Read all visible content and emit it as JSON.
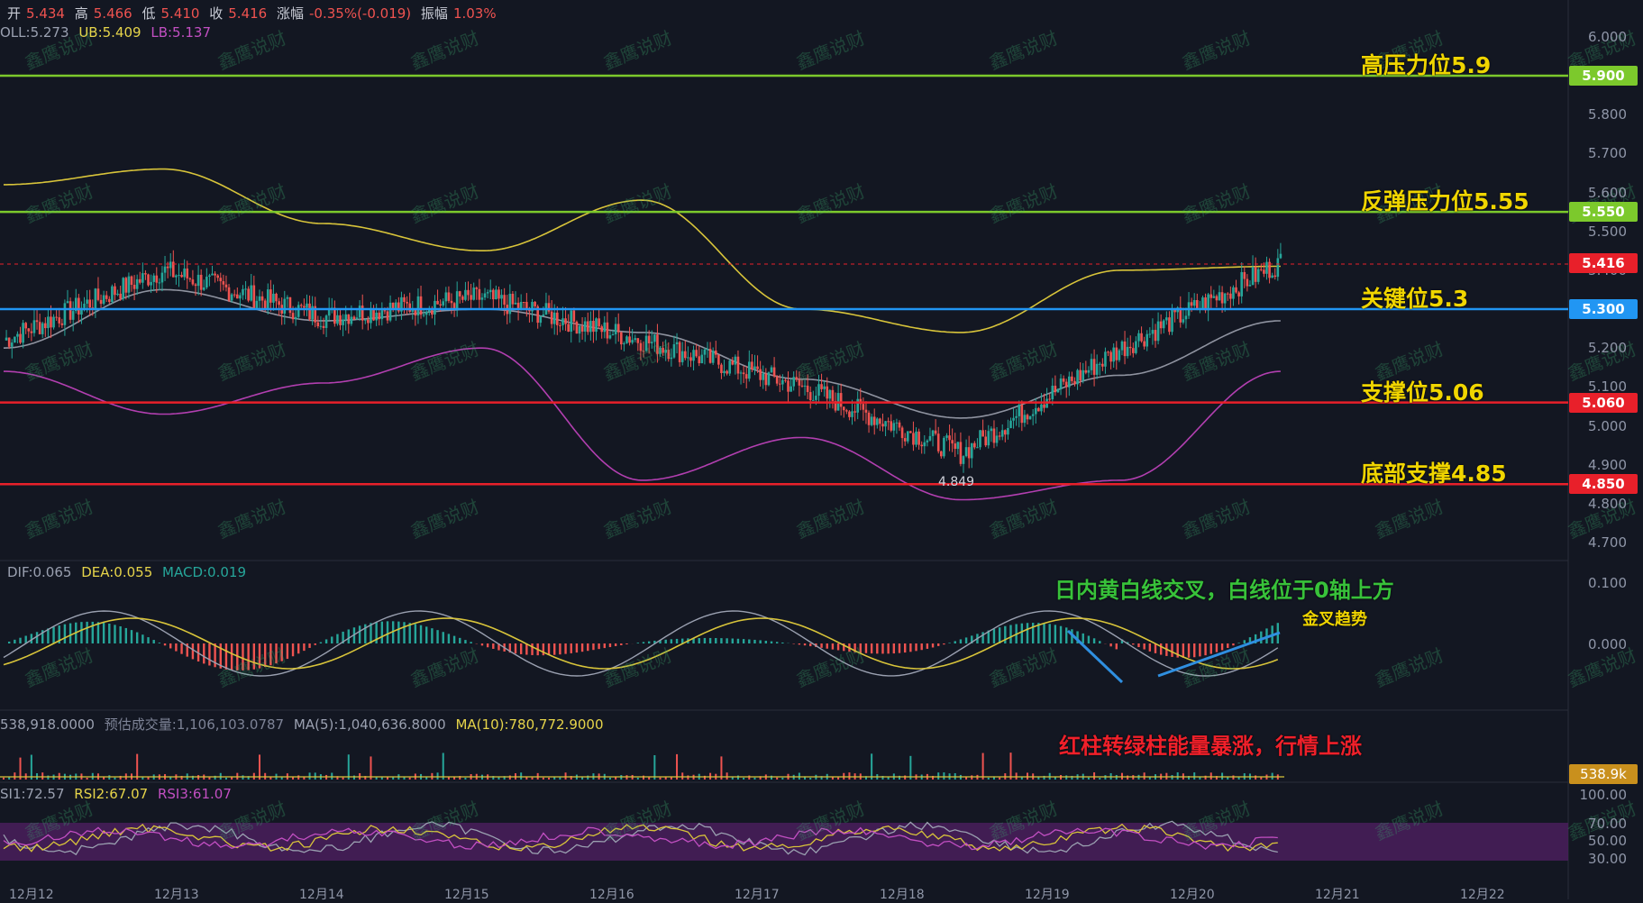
{
  "header": {
    "open_label": "开",
    "open": "5.434",
    "high_label": "高",
    "high": "5.466",
    "low_label": "低",
    "low": "5.410",
    "close_label": "收",
    "close": "5.416",
    "change_label": "涨幅",
    "change": "-0.35%(-0.019)",
    "amp_label": "振幅",
    "amp": "1.03%"
  },
  "boll": {
    "mid": "OLL:5.273",
    "ub": "UB:5.409",
    "lb": "LB:5.137"
  },
  "macd": {
    "dif": "DIF:0.065",
    "dea": "DEA:0.055",
    "macd": "MACD:0.019"
  },
  "volume": {
    "vol": "538,918.0000",
    "est": "预估成交量:1,106,103.0787",
    "ma5": "MA(5):1,040,636.8000",
    "ma10": "MA(10):780,772.9000",
    "tag": "538.9k"
  },
  "rsi": {
    "rsi1": "SI1:72.57",
    "rsi2": "RSI2:67.07",
    "rsi3": "RSI3:61.07"
  },
  "price_axis": [
    "6.000",
    "5.900",
    "5.800",
    "5.700",
    "5.600",
    "5.500",
    "5.400",
    "5.300",
    "5.200",
    "5.100",
    "5.000",
    "4.900",
    "4.800",
    "4.700"
  ],
  "macd_axis": [
    "0.100",
    "0.000"
  ],
  "rsi_axis": [
    "100.00",
    "70.00",
    "50.00",
    "30.00"
  ],
  "levels": [
    {
      "text": "高压力位5.9",
      "value": 5.9,
      "tag": "5.900",
      "color": "#7cc92c"
    },
    {
      "text": "反弹压力位5.55",
      "value": 5.55,
      "tag": "5.550",
      "color": "#7cc92c"
    },
    {
      "text": "关键位5.3",
      "value": 5.3,
      "tag": "5.300",
      "color": "#2196f3"
    },
    {
      "text": "支撑位5.06",
      "value": 5.06,
      "tag": "5.060",
      "color": "#e8202a"
    },
    {
      "text": "底部支撑4.85",
      "value": 4.85,
      "tag": "4.850",
      "color": "#e8202a"
    }
  ],
  "current_price_tag": "5.416",
  "low_marker": "4.849",
  "notes": {
    "macd_note": "日内黄白线交叉，白线位于0轴上方",
    "golden_cross": "金叉趋势",
    "volume_note": "红柱转绿柱能量暴涨，行情上涨"
  },
  "dates": [
    "12月12",
    "12月13",
    "12月14",
    "12月15",
    "12月16",
    "12月17",
    "12月18",
    "12月19",
    "12月20",
    "12月21",
    "12月22"
  ],
  "watermark": "鑫鹰说财",
  "chart_data": {
    "type": "line",
    "title": "",
    "x": [
      "12月12",
      "12月13",
      "12月14",
      "12月15",
      "12月16",
      "12月17",
      "12月18",
      "12月19",
      "12月20"
    ],
    "series": [
      {
        "values": [
          5.22,
          5.4,
          5.28,
          5.33,
          5.22,
          5.1,
          4.93,
          5.2,
          5.42
        ]
      },
      {
        "values": [
          5.2,
          5.35,
          5.27,
          5.3,
          5.24,
          5.12,
          5.02,
          5.13,
          5.27
        ]
      },
      {
        "values": [
          5.62,
          5.66,
          5.52,
          5.45,
          5.58,
          5.3,
          5.24,
          5.4,
          5.41
        ]
      },
      {
        "values": [
          5.14,
          5.03,
          5.11,
          5.2,
          4.86,
          4.97,
          4.81,
          4.86,
          5.14
        ]
      }
    ],
    "ylim": [
      4.66,
      6.02
    ],
    "colors": {
      "up": "#26a69a",
      "down": "#ef5350"
    }
  }
}
